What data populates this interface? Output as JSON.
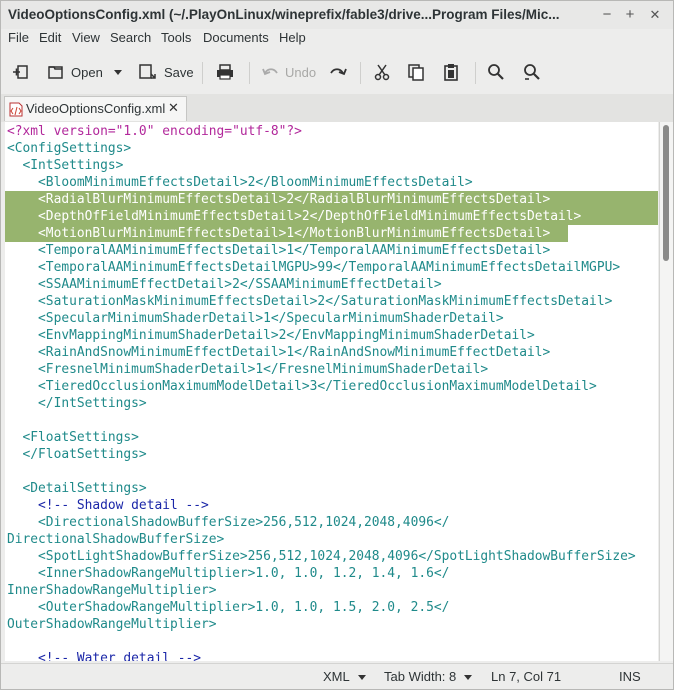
{
  "window": {
    "title": "VideoOptionsConfig.xml (~/.PlayOnLinux/wineprefix/fable3/drive...Program Files/Mic...",
    "minimize_glyph": "−",
    "maximize_glyph": "+",
    "close_glyph": "✕"
  },
  "menu": [
    "File",
    "Edit",
    "View",
    "Search",
    "Tools",
    "Documents",
    "Help"
  ],
  "toolbar": {
    "new_icon": "new-document-icon",
    "open_label": "Open",
    "save_label": "Save",
    "print_icon": "printer-icon",
    "undo_label": "Undo",
    "redo_icon": "redo-icon",
    "cut_icon": "scissors-icon",
    "copy_icon": "copy-icon",
    "paste_icon": "clipboard-icon",
    "find_icon": "magnifier-icon",
    "replace_icon": "magnifier-replace-icon"
  },
  "tab": {
    "label": "VideoOptionsConfig.xml",
    "icon": "xml-file-icon",
    "close_glyph": "✕"
  },
  "editor": {
    "lines": [
      "<?xml version=\"1.0\" encoding=\"utf-8\"?>",
      "<ConfigSettings>",
      "  <IntSettings>",
      "    <BloomMinimumEffectsDetail>2</BloomMinimumEffectsDetail>",
      "    <RadialBlurMinimumEffectsDetail>2</RadialBlurMinimumEffectsDetail>",
      "    <DepthOfFieldMinimumEffectsDetail>2</DepthOfFieldMinimumEffectsDetail>",
      "    <MotionBlurMinimumEffectsDetail>1</MotionBlurMinimumEffectsDetail>",
      "    <TemporalAAMinimumEffectsDetail>1</TemporalAAMinimumEffectsDetail>",
      "    <TemporalAAMinimumEffectsDetailMGPU>99</TemporalAAMinimumEffectsDetailMGPU>",
      "    <SSAAMinimumEffectDetail>2</SSAAMinimumEffectDetail>",
      "    <SaturationMaskMinimumEffectsDetail>2</SaturationMaskMinimumEffectsDetail>",
      "    <SpecularMinimumShaderDetail>1</SpecularMinimumShaderDetail>",
      "    <EnvMappingMinimumShaderDetail>2</EnvMappingMinimumShaderDetail>",
      "    <RainAndSnowMinimumEffectDetail>1</RainAndSnowMinimumEffectDetail>",
      "    <FresnelMinimumShaderDetail>1</FresnelMinimumShaderDetail>",
      "    <TieredOcclusionMaximumModelDetail>3</TieredOcclusionMaximumModelDetail>",
      "    </IntSettings>",
      "",
      "  <FloatSettings>",
      "  </FloatSettings>",
      "",
      "  <DetailSettings>",
      "    <!-- Shadow detail -->",
      "    <DirectionalShadowBufferSize>256,512,1024,2048,4096</",
      "DirectionalShadowBufferSize>",
      "    <SpotLightShadowBufferSize>256,512,1024,2048,4096</SpotLightShadowBufferSize>",
      "    <InnerShadowRangeMultiplier>1.0, 1.0, 1.2, 1.4, 1.6</",
      "InnerShadowRangeMultiplier>",
      "    <OuterShadowRangeMultiplier>1.0, 1.0, 1.5, 2.0, 2.5</",
      "OuterShadowRangeMultiplier>",
      "",
      "    <!-- Water detail -->"
    ],
    "selection_color": "#97b46e",
    "tag_color": "#1f8a8a",
    "declaration_color": "#b2289b",
    "comment_color": "#1a26a8"
  },
  "statusbar": {
    "language": "XML",
    "tab_width": "Tab Width:  8",
    "position": "Ln 7, Col 71",
    "mode": "INS"
  }
}
